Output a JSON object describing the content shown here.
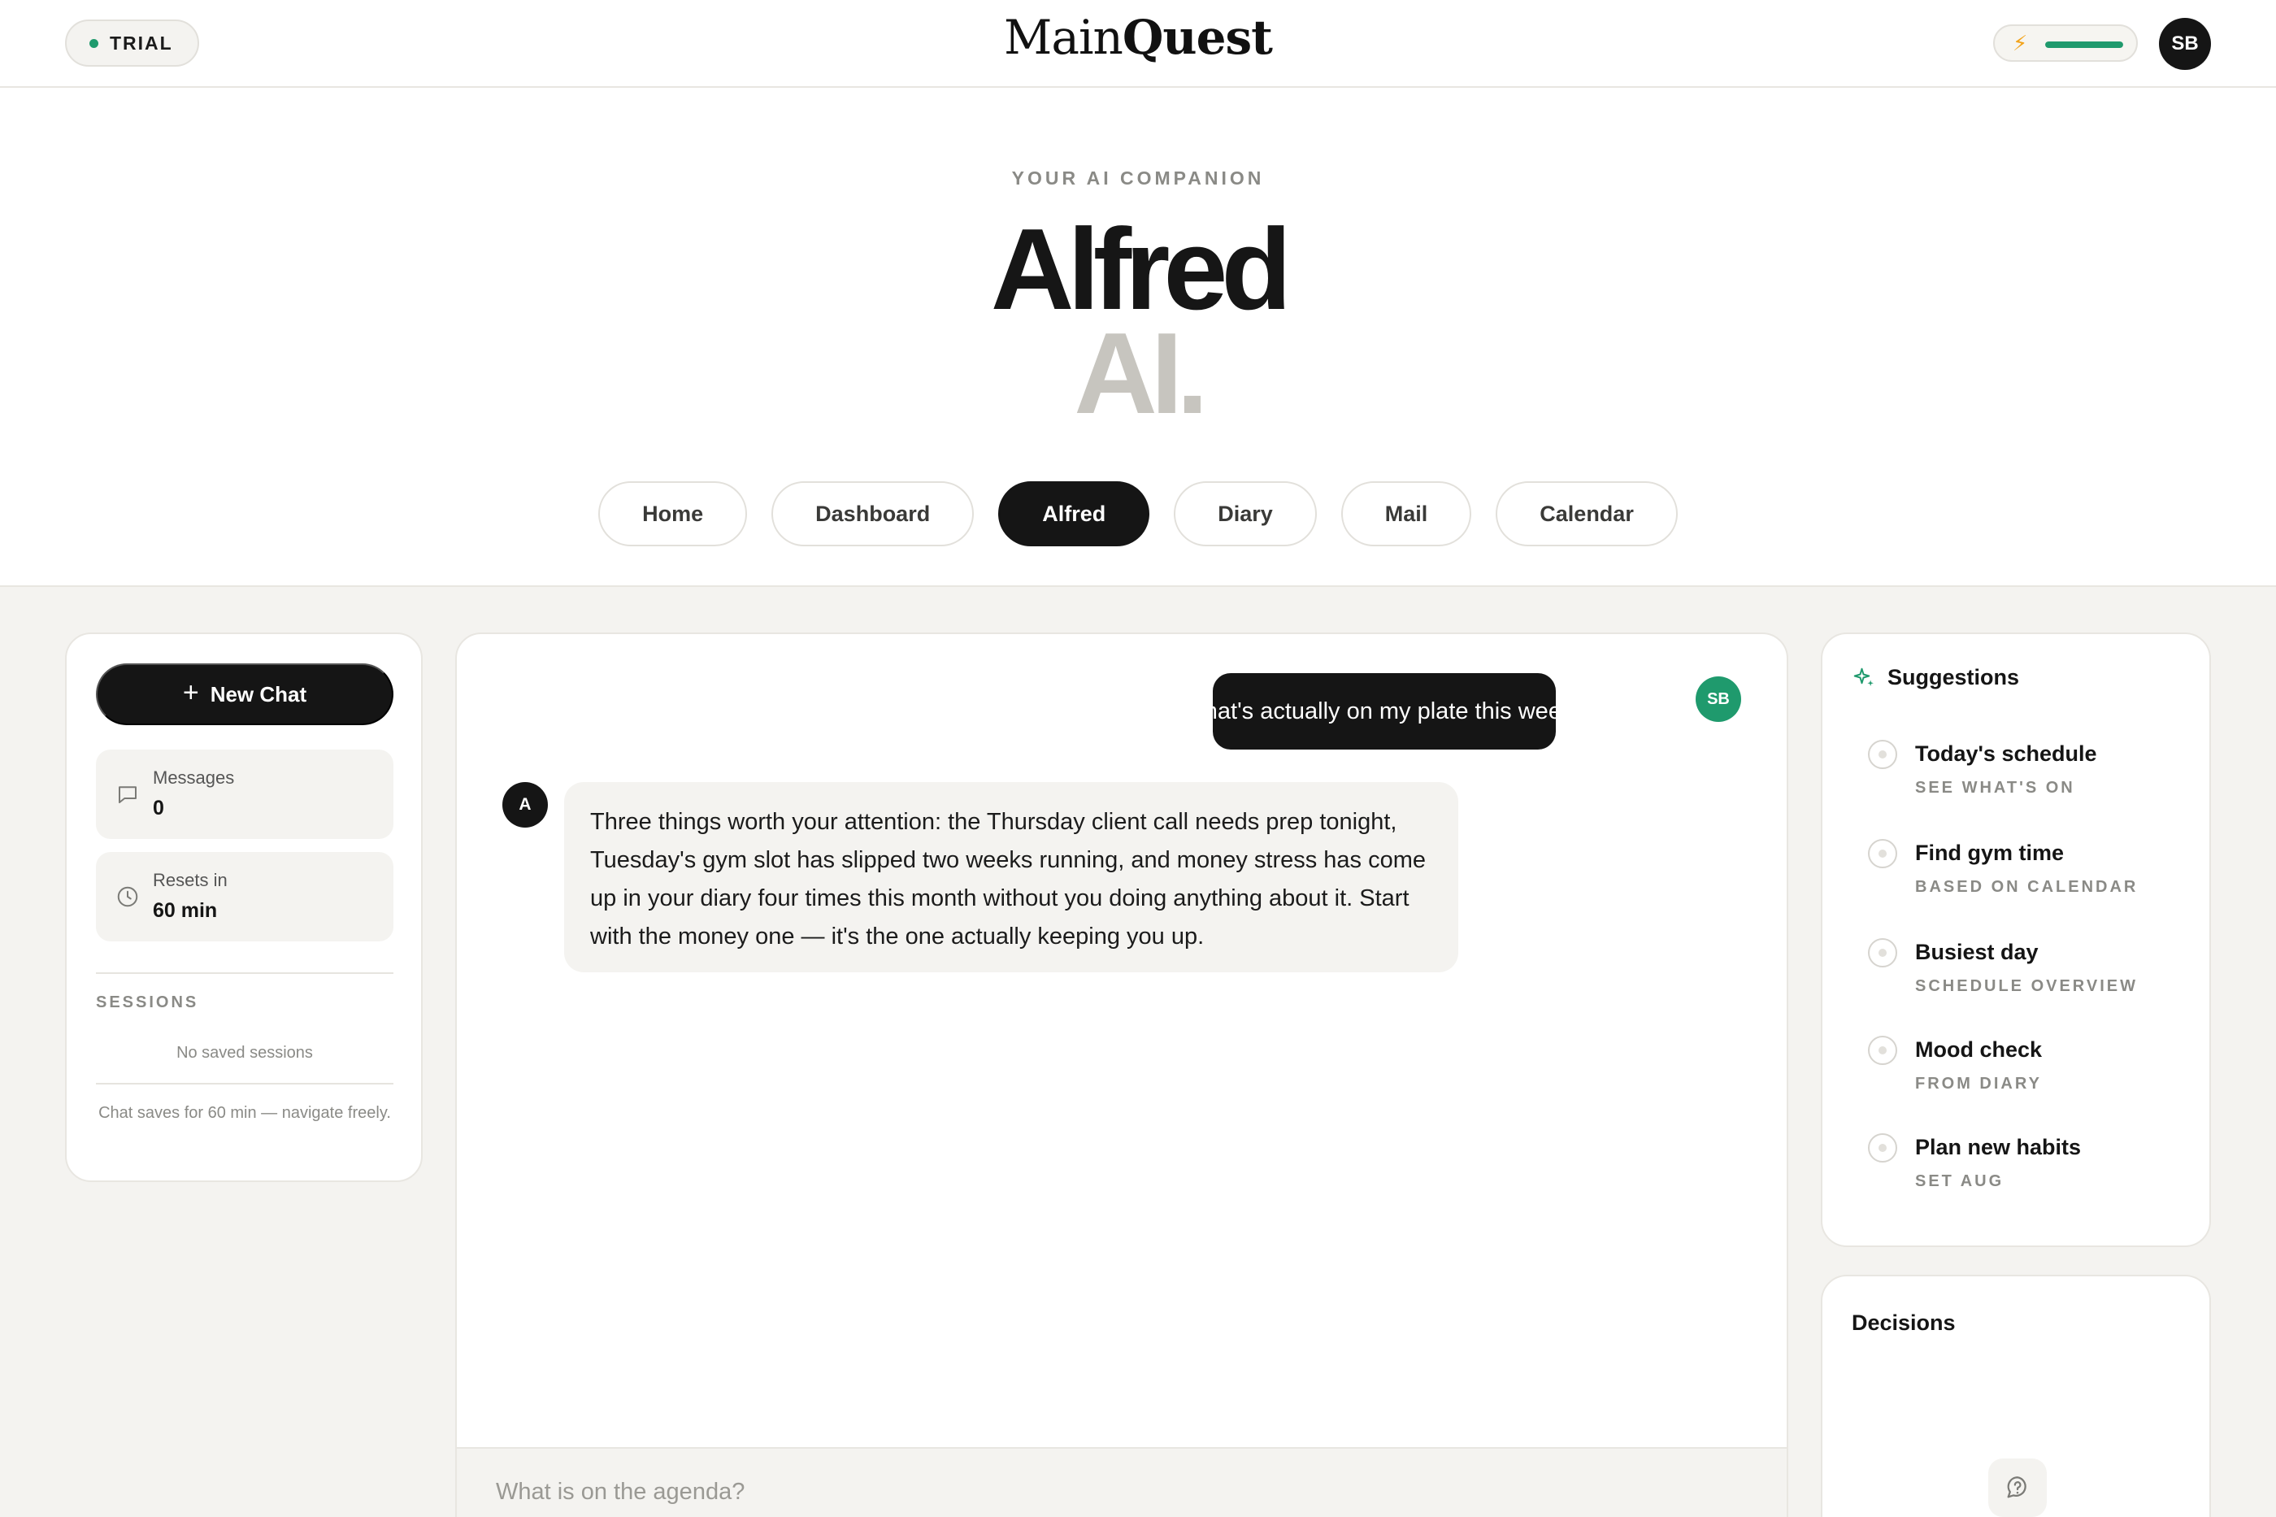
{
  "header": {
    "trial_label": "TRIAL",
    "logo_regular": "Main",
    "logo_bold": "Quest",
    "energy_level": 1.0,
    "energy_color": "#1f9a6d",
    "user_initials": "SB"
  },
  "hero": {
    "eyebrow": "YOUR AI COMPANION",
    "title": "Alfred",
    "subtitle": "AI."
  },
  "nav": {
    "items": [
      {
        "label": "Home",
        "active": false
      },
      {
        "label": "Dashboard",
        "active": false
      },
      {
        "label": "Alfred",
        "active": true
      },
      {
        "label": "Diary",
        "active": false
      },
      {
        "label": "Mail",
        "active": false
      },
      {
        "label": "Calendar",
        "active": false
      }
    ]
  },
  "sidebar": {
    "new_chat_label": "New Chat",
    "messages_label": "Messages",
    "messages_value": "0",
    "resets_label": "Resets in",
    "resets_value": "60 min",
    "sessions_heading": "SESSIONS",
    "empty_sessions": "No saved sessions",
    "save_note": "Chat saves for 60 min — navigate freely."
  },
  "chat": {
    "messages": [
      {
        "role": "user",
        "avatar": "SB",
        "text": "What's actually on my plate this week?"
      },
      {
        "role": "assistant",
        "avatar": "A",
        "text": "Three things worth your attention: the Thursday client call needs prep tonight, Tuesday's gym slot has slipped two weeks running, and money stress has come up in your diary four times this month without you doing anything about it. Start with the money one — it's the one actually keeping you up."
      }
    ],
    "input_placeholder": "What is on the agenda?"
  },
  "suggestions": {
    "heading": "Suggestions",
    "items": [
      {
        "title": "Today's schedule",
        "subtitle": "SEE WHAT'S ON"
      },
      {
        "title": "Find gym time",
        "subtitle": "BASED ON CALENDAR"
      },
      {
        "title": "Busiest day",
        "subtitle": "SCHEDULE OVERVIEW"
      },
      {
        "title": "Mood check",
        "subtitle": "FROM DIARY"
      },
      {
        "title": "Plan new habits",
        "subtitle": "SET AUG"
      }
    ]
  },
  "decisions": {
    "heading": "Decisions"
  },
  "colors": {
    "accent": "#1f9a6d",
    "dark": "#151515",
    "surface": "#f4f3f0"
  }
}
